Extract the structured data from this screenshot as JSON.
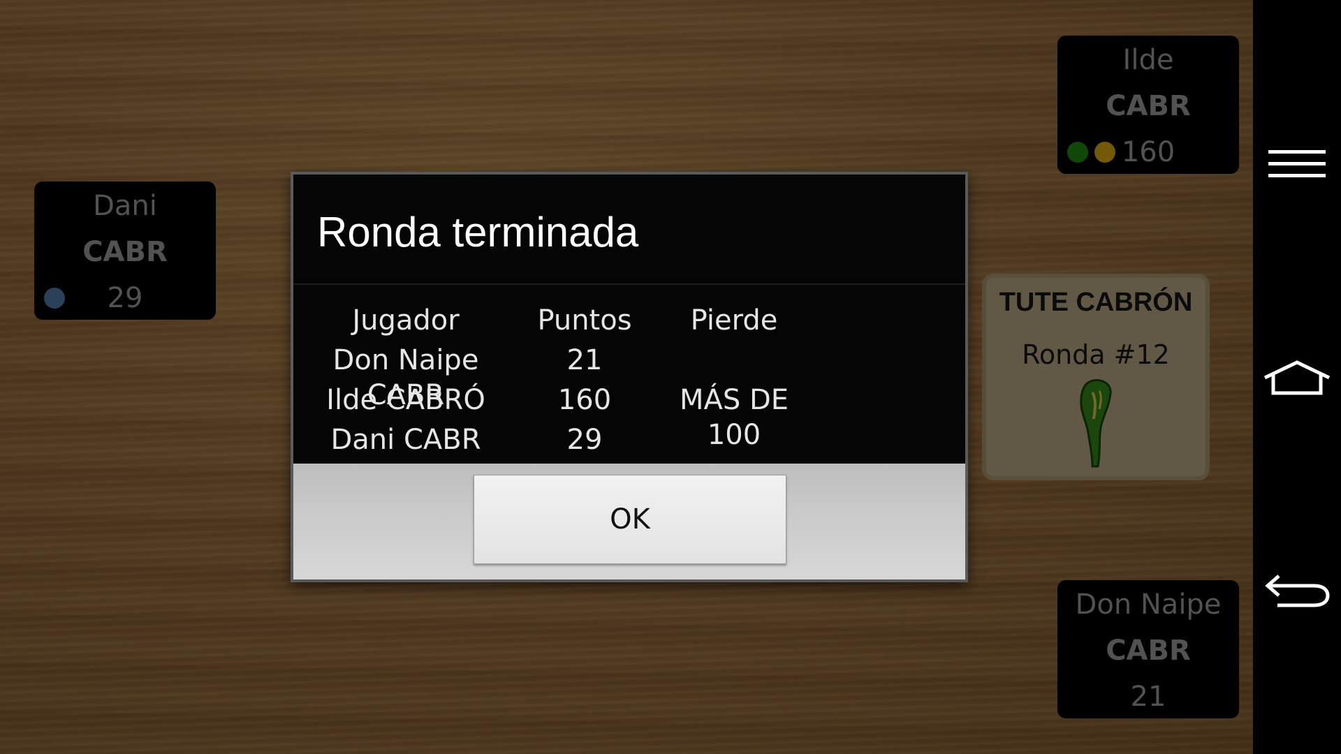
{
  "players": {
    "ilde": {
      "name": "Ilde",
      "game": "CABR",
      "score": "160",
      "chip_colors": [
        "#1f7a12",
        "#c89a10"
      ]
    },
    "dani": {
      "name": "Dani",
      "game": "CABR",
      "score": "29",
      "chip_colors": [
        "#4a6f9a"
      ]
    },
    "don_naipe": {
      "name": "Don Naipe",
      "game": "CABR",
      "score": "21"
    }
  },
  "info_card": {
    "title": "TUTE CABRÓN",
    "round": "Ronda #12",
    "icon": "club-icon"
  },
  "dialog": {
    "title": "Ronda terminada",
    "columns": [
      "Jugador",
      "Puntos",
      "Pierde"
    ],
    "rows": [
      [
        "Don Naipe CABR",
        "21",
        ""
      ],
      [
        "Ilde CABRÓ",
        "160",
        "MÁS DE 100"
      ],
      [
        "Dani CABR",
        "29",
        ""
      ]
    ],
    "ok_label": "OK"
  },
  "navbar": {
    "icons": [
      "menu-icon",
      "home-icon",
      "back-icon"
    ]
  },
  "colors": {
    "table_wood": "#8a6136",
    "panel_bg": "#000000",
    "panel_text": "#8e8e8e",
    "card_bg": "#a89a77"
  }
}
